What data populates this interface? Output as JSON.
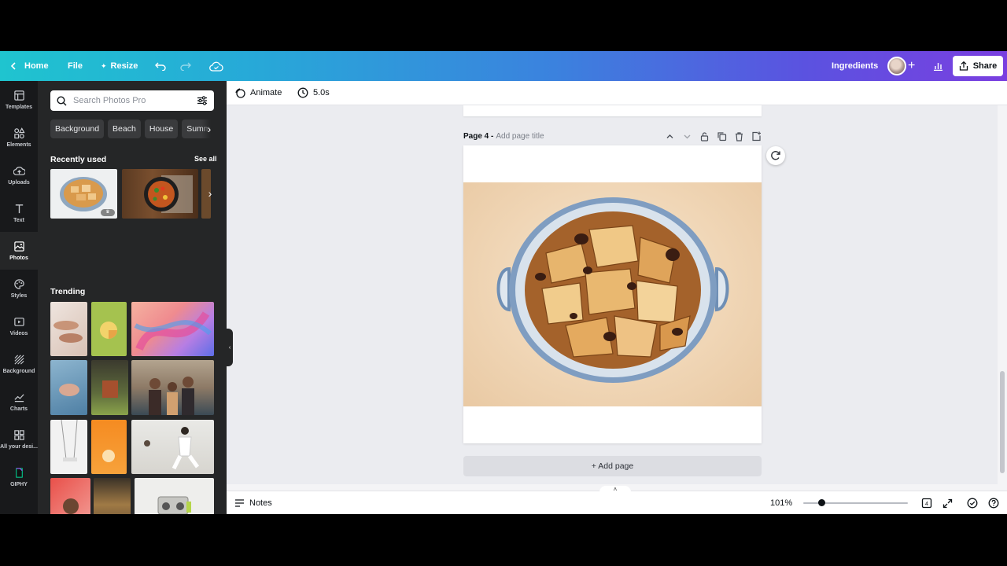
{
  "topbar": {
    "home": "Home",
    "file": "File",
    "resize": "Resize",
    "design_title": "Ingredients",
    "share": "Share"
  },
  "rail": [
    {
      "label": "Templates",
      "icon": "templates-icon"
    },
    {
      "label": "Elements",
      "icon": "elements-icon"
    },
    {
      "label": "Uploads",
      "icon": "uploads-icon"
    },
    {
      "label": "Text",
      "icon": "text-icon"
    },
    {
      "label": "Photos",
      "icon": "photos-icon",
      "active": true
    },
    {
      "label": "Styles",
      "icon": "styles-icon"
    },
    {
      "label": "Videos",
      "icon": "videos-icon"
    },
    {
      "label": "Background",
      "icon": "background-icon"
    },
    {
      "label": "Charts",
      "icon": "charts-icon"
    },
    {
      "label": "All your desi...",
      "icon": "all-designs-icon"
    },
    {
      "label": "GIPHY",
      "icon": "giphy-icon"
    }
  ],
  "panel": {
    "search_placeholder": "Search Photos Pro",
    "chips": [
      "Background",
      "Beach",
      "House",
      "Summer"
    ],
    "recently_used": "Recently used",
    "see_all": "See all",
    "trending": "Trending"
  },
  "editor": {
    "animate": "Animate",
    "duration": "5.0s"
  },
  "page": {
    "name": "Page 4 -",
    "title_placeholder": "Add page title"
  },
  "add_page": "+ Add page",
  "footer": {
    "notes": "Notes",
    "zoom": "101%",
    "page_count": "4"
  },
  "colors": {
    "header_gradient_start": "#1fc4cf",
    "header_gradient_end": "#7a3fe0",
    "panel_bg": "#252627",
    "rail_bg": "#18191b",
    "canvas_bg": "#ebecf0"
  }
}
